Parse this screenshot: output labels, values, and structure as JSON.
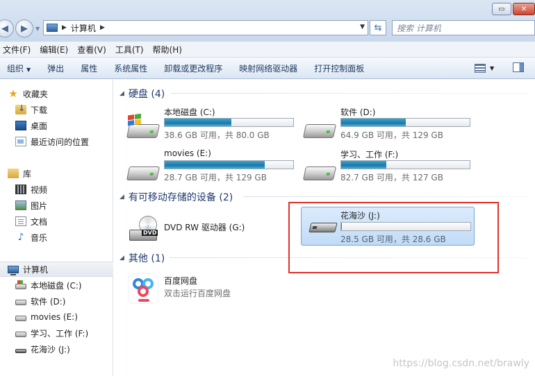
{
  "address": {
    "crumb": "计算机",
    "search_placeholder": "搜索 计算机"
  },
  "menu": [
    "文件(F)",
    "编辑(E)",
    "查看(V)",
    "工具(T)",
    "帮助(H)"
  ],
  "toolbar": [
    "组织",
    "弹出",
    "属性",
    "系统属性",
    "卸载或更改程序",
    "映射网络驱动器",
    "打开控制面板"
  ],
  "sidebar": {
    "favorites": {
      "label": "收藏夹",
      "items": [
        "下载",
        "桌面",
        "最近访问的位置"
      ]
    },
    "libraries": {
      "label": "库",
      "items": [
        "视频",
        "图片",
        "文档",
        "音乐"
      ]
    },
    "computer": {
      "label": "计算机",
      "items": [
        "本地磁盘 (C:)",
        "软件 (D:)",
        "movies (E:)",
        "学习、工作 (F:)",
        "花海沙 (J:)"
      ]
    }
  },
  "groups": {
    "hdd": "硬盘 (4)",
    "removable": "有可移动存储的设备 (2)",
    "other": "其他 (1)"
  },
  "drives": [
    {
      "name": "本地磁盘 (C:)",
      "stat": "38.6 GB 可用，共 80.0 GB",
      "used_fraction": 0.52
    },
    {
      "name": "软件 (D:)",
      "stat": "64.9 GB 可用，共 129 GB",
      "used_fraction": 0.5
    },
    {
      "name": "movies (E:)",
      "stat": "28.7 GB 可用，共 129 GB",
      "used_fraction": 0.78
    },
    {
      "name": "学习、工作 (F:)",
      "stat": "82.7 GB 可用，共 127 GB",
      "used_fraction": 0.35
    }
  ],
  "dvd": {
    "name": "DVD RW 驱动器 (G:)",
    "badge": "DVD"
  },
  "usb": {
    "name": "花海沙 (J:)",
    "stat": "28.5 GB 可用，共 28.6 GB",
    "used_fraction": 0.005
  },
  "baidu": {
    "name": "百度网盘",
    "sub": "双击运行百度网盘"
  },
  "watermark": "https://blog.csdn.net/brawly"
}
